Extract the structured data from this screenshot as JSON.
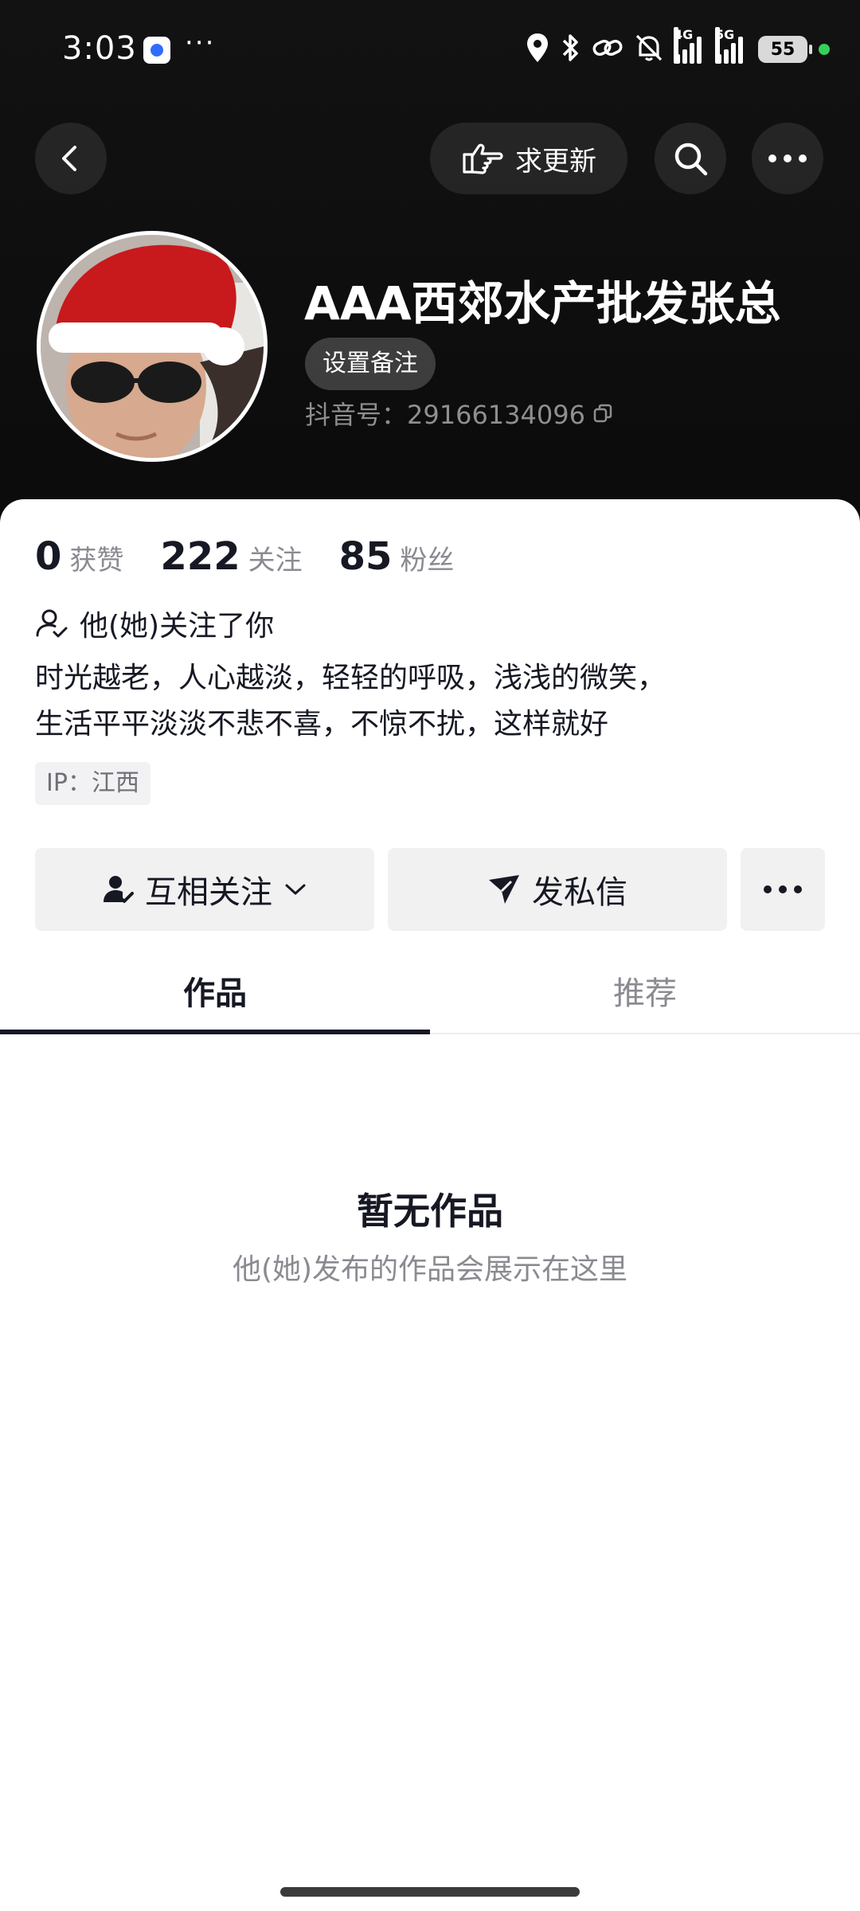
{
  "status_bar": {
    "time": "3:03",
    "more_dots": "···",
    "network_4g": "4G",
    "network_5g": "5G",
    "battery": "55"
  },
  "nav": {
    "request_update_label": "求更新"
  },
  "profile": {
    "name": "AAA西郊水产批发张总",
    "remark_label": "设置备注",
    "douyin_id": "抖音号：29166134096"
  },
  "stats": {
    "likes_count": "0",
    "likes_label": "获赞",
    "following_count": "222",
    "following_label": "关注",
    "followers_count": "85",
    "followers_label": "粉丝"
  },
  "follow_hint": "他(她)关注了你",
  "bio": {
    "line1": "时光越老，人心越淡，轻轻的呼吸，浅浅的微笑，",
    "line2": "生活平平淡淡不悲不喜，不惊不扰，这样就好"
  },
  "ip_location": "IP：江西",
  "actions": {
    "mutual_follow_label": "互相关注",
    "message_label": "发私信"
  },
  "tabs": [
    {
      "label": "作品",
      "active": true
    },
    {
      "label": "推荐",
      "active": false
    }
  ],
  "empty_state": {
    "title": "暂无作品",
    "description": "他(她)发布的作品会展示在这里"
  },
  "colors": {
    "header_bg": "#0f0f0f",
    "text_primary": "#161823",
    "text_secondary": "#8a8b91",
    "button_bg": "#f1f1f2",
    "status_green": "#35d05a"
  }
}
